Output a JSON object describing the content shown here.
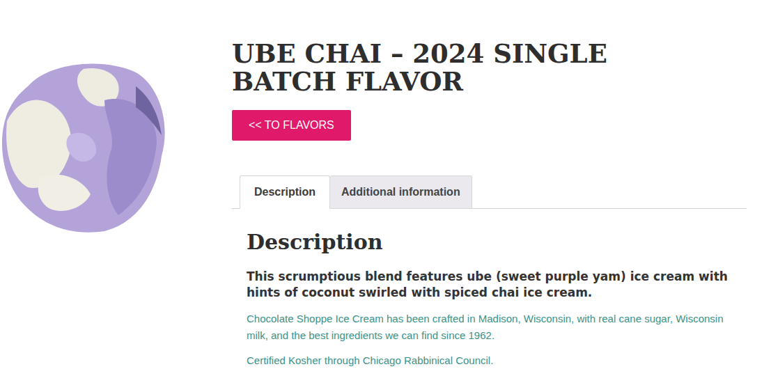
{
  "product": {
    "title": "UBE CHAI – 2024 SINGLE BATCH FLAVOR"
  },
  "back_button": "<< TO FLAVORS",
  "tabs": [
    {
      "label": "Description",
      "selected": true
    },
    {
      "label": "Additional information",
      "selected": false
    }
  ],
  "description": {
    "heading": "Description",
    "lead": "This scrumptious blend features ube (sweet purple yam) ice cream with hints of coconut swirled with spiced chai ice cream.",
    "paragraphs": [
      "Chocolate Shoppe Ice Cream has been crafted in Madison, Wisconsin, with real cane sugar, Wisconsin milk, and the best ingredients we can find since 1962.",
      "Certified Kosher through Chicago Rabbinical Council."
    ]
  }
}
